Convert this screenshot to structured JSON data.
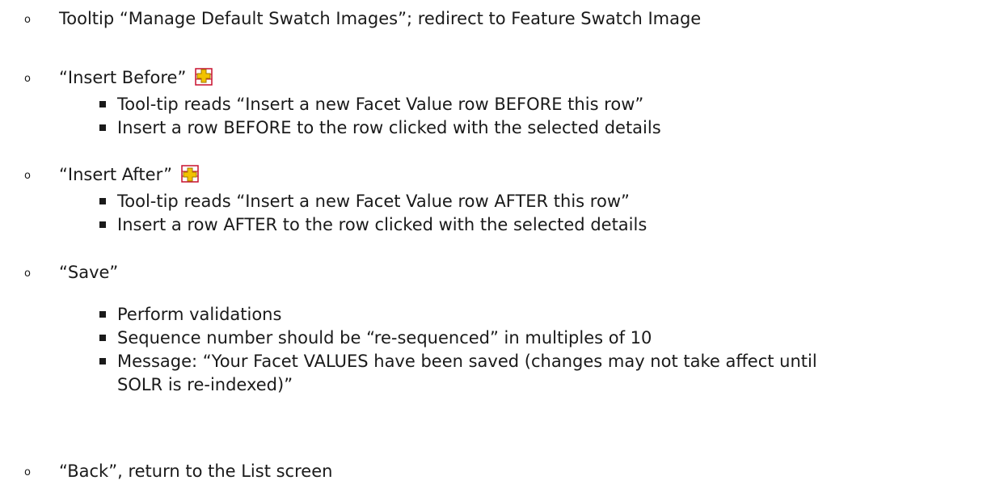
{
  "items": [
    {
      "text": "Tooltip “Manage Default Swatch Images”; redirect to Feature Swatch Image",
      "subitems": []
    },
    {
      "text": "“Insert Before”",
      "icon": "insert-before-icon",
      "subitems": [
        "Tool-tip reads “Insert a new Facet Value row BEFORE this row”",
        "Insert a row BEFORE to the row clicked with the selected details"
      ]
    },
    {
      "text": "“Insert After”",
      "icon": "insert-after-icon",
      "subitems": [
        "Tool-tip reads “Insert a new Facet Value row AFTER this row”",
        "Insert a row AFTER to the row clicked with the selected details"
      ]
    },
    {
      "text": "“Save”",
      "subitems": [
        "Perform validations",
        "Sequence number should be “re-sequenced” in multiples of 10",
        "Message: “Your Facet VALUES have been saved (changes may not take affect until",
        "SOLR is re-indexed)”"
      ]
    },
    {
      "text": "“Back”, return to the List screen",
      "subitems": []
    }
  ],
  "colors": {
    "text": "#1a1a1a",
    "icon_yellow": "#f2c200",
    "icon_border": "#c8102e"
  }
}
